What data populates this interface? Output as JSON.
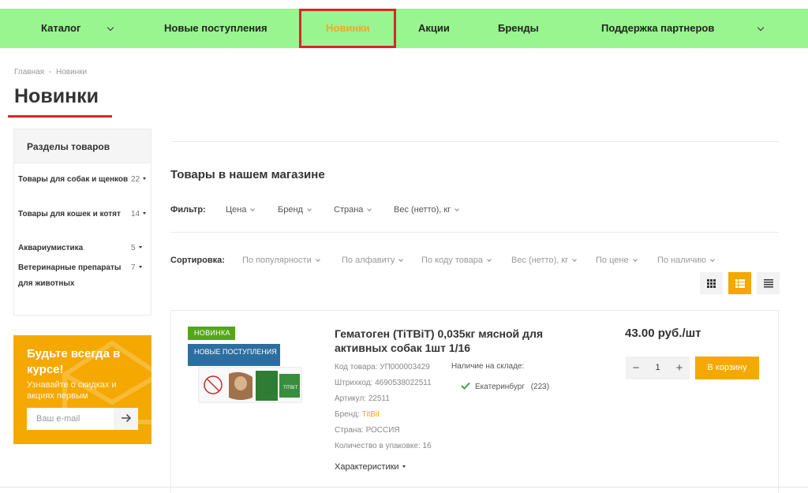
{
  "nav": {
    "items": [
      {
        "label": "Каталог",
        "has_dropdown": true
      },
      {
        "label": "Новые поступления",
        "has_dropdown": false
      },
      {
        "label": "Новинки",
        "has_dropdown": false,
        "active": true
      },
      {
        "label": "Акции",
        "has_dropdown": false
      },
      {
        "label": "Бренды",
        "has_dropdown": false
      },
      {
        "label": "Поддержка партнеров",
        "has_dropdown": true
      }
    ]
  },
  "breadcrumb": {
    "home": "Главная",
    "separator": "-",
    "current": "Новинки"
  },
  "page_title": "Новинки",
  "sidebar": {
    "heading": "Разделы товаров",
    "items": [
      {
        "label": "Товары для собак и щенков",
        "count": "22"
      },
      {
        "label": "Товары для кошек и котят",
        "count": "14"
      },
      {
        "label": "Аквариумистика",
        "count": "5"
      },
      {
        "label": "Ветеринарные препараты для животных",
        "count": "7"
      }
    ]
  },
  "promo": {
    "title": "Будьте всегда в курсе!",
    "subtitle": "Узнавайте о скидках и акциях первым",
    "email_placeholder": "Ваш e-mail"
  },
  "main": {
    "section_title": "Товары в нашем магазине",
    "filter": {
      "label": "Фильтр:",
      "items": [
        "Цена",
        "Бренд",
        "Страна",
        "Вес (нетто), кг"
      ]
    },
    "sort": {
      "label": "Сортировка:",
      "items": [
        "По популярности",
        "По алфавиту",
        "По коду товара",
        "Вес (нетто), кг",
        "По цене",
        "По наличию"
      ]
    },
    "view_modes": [
      {
        "icon": "grid-view-icon",
        "active": false
      },
      {
        "icon": "list-view-icon",
        "active": true
      },
      {
        "icon": "compact-list-view-icon",
        "active": false
      }
    ]
  },
  "product": {
    "badge_new": "НОВИНКА",
    "badge_arrivals": "НОВЫЕ ПОСТУПЛЕНИЯ",
    "name": "Гематоген (TiTBiT) 0,035кг мясной для активных собак 1шт 1/16",
    "props": {
      "code": "Код товара: УП000003429",
      "barcode": "Штрихкод: 4690538022511",
      "article": "Артикул: 22511",
      "brand_label": "Бренд: ",
      "brand_value": "TitBit",
      "country": "Страна: РОССИЯ",
      "pack_qty": "Количество в упаковке: 16"
    },
    "stock_label": "Наличие на складе:",
    "stock_city": "Екатеринбург",
    "stock_count": "(223)",
    "characteristics": "Характеристики",
    "price": "43.00 руб./шт",
    "qty": "1",
    "minus": "−",
    "plus": "+",
    "cart_label": "В корзину",
    "image_brand": "TiTBiT"
  },
  "colors": {
    "nav_bg": "#98f58f",
    "accent": "#f5a800",
    "highlight_red": "#d9262a",
    "badge_new": "#56a61b",
    "badge_arrivals": "#2d6ea0"
  }
}
